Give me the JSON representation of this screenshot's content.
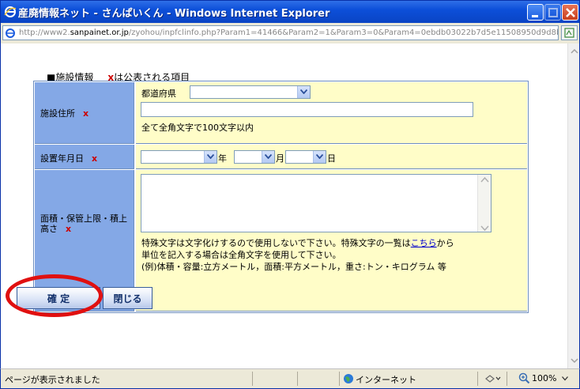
{
  "window": {
    "title": "産廃情報ネット - さんぱいくん - Windows Internet Explorer"
  },
  "address": {
    "url_prefix": "http://www2.",
    "url_domain": "sanpainet.or.jp",
    "url_path": "/zyohou/inpfclinfo.php?Param1=41466&Param2=1&Param3=0&Param4=0ebdb03022b7d5e11508950d9d8b"
  },
  "form": {
    "section_title": "■施設情報",
    "required_note": "は公表される項目",
    "required_mark": "x",
    "address_label": "施設住所",
    "prefecture_label": "都道府県",
    "prefecture_value": "",
    "address_value": "",
    "address_hint": "全て全角文字で100文字以内",
    "date_label": "設置年月日",
    "year_value": "",
    "year_unit": "年",
    "month_value": "",
    "month_unit": "月",
    "day_value": "",
    "day_unit": "日",
    "area_label_line1": "面積・保管上限・積上",
    "area_label_line2": "高さ",
    "area_value": "",
    "note1_before": "特殊文字は文字化けするので使用しないで下さい。特殊文字の一覧は",
    "note1_link": "こちら",
    "note1_after": "から",
    "note2": "単位を記入する場合は全角文字を使用して下さい。",
    "note3": "(例)体積・容量:立方メートル，面積:平方メートル，重さ:トン・キログラム 等"
  },
  "buttons": {
    "confirm": "確 定",
    "close": "閉じる"
  },
  "status": {
    "message": "ページが表示されました",
    "zone": "インターネット",
    "zoom": "100%"
  },
  "colors": {
    "label_bg": "#84a8e6",
    "value_bg": "#fffdc8",
    "required": "#cc0000",
    "highlight_circle": "#e01010"
  }
}
